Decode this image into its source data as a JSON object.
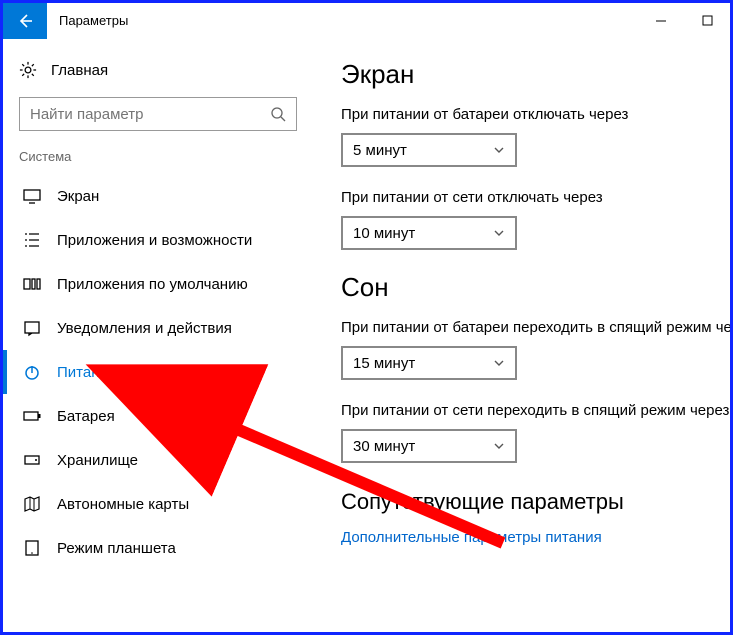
{
  "titlebar": {
    "title": "Параметры"
  },
  "sidebar": {
    "home": "Главная",
    "search_placeholder": "Найти параметр",
    "category": "Система",
    "items": [
      {
        "label": "Экран"
      },
      {
        "label": "Приложения и возможности"
      },
      {
        "label": "Приложения по умолчанию"
      },
      {
        "label": "Уведомления и действия"
      },
      {
        "label": "Питание и спящий режим"
      },
      {
        "label": "Батарея"
      },
      {
        "label": "Хранилище"
      },
      {
        "label": "Автономные карты"
      },
      {
        "label": "Режим планшета"
      }
    ]
  },
  "main": {
    "screen": {
      "heading": "Экран",
      "battery_off_label": "При питании от батареи отключать через",
      "battery_off_value": "5 минут",
      "plugged_off_label": "При питании от сети отключать через",
      "plugged_off_value": "10 минут"
    },
    "sleep": {
      "heading": "Сон",
      "battery_sleep_label": "При питании от батареи переходить в спящий режим че",
      "battery_sleep_value": "15 минут",
      "plugged_sleep_label": "При питании от сети переходить в спящий режим через",
      "plugged_sleep_value": "30 минут"
    },
    "related": {
      "heading": "Сопутствующие параметры",
      "link": "Дополнительные параметры питания"
    }
  }
}
